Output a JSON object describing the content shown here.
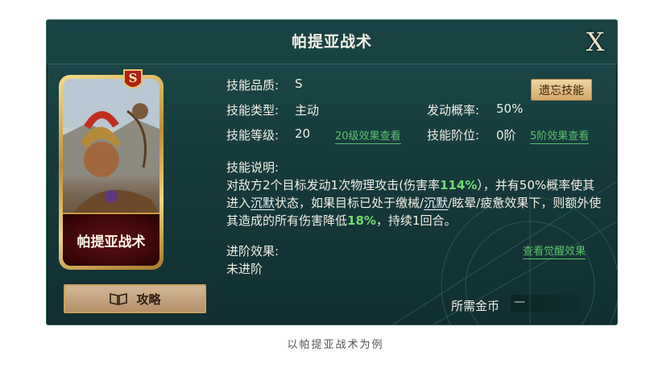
{
  "window": {
    "title": "帕提亚战术",
    "close_label": "X"
  },
  "card": {
    "grade_letter": "S",
    "name": "帕提亚战术"
  },
  "guide_button": {
    "label": "攻略"
  },
  "skill": {
    "quality_label": "技能品质:",
    "quality_value": "S",
    "type_label": "技能类型:",
    "type_value": "主动",
    "level_label": "技能等级:",
    "level_value": "20",
    "level_link": "20级效果查看",
    "trigger_label": "发动概率:",
    "trigger_value": "50%",
    "tier_label": "技能阶位:",
    "tier_value": "0阶",
    "tier_link": "5阶效果查看",
    "forget_button": "遗忘技能"
  },
  "description": {
    "label": "技能说明:",
    "p1": "对敌方2个目标发动1次物理攻击(伤害率",
    "dmg_rate": "114%",
    "p2": "），并有50%概率使其进入",
    "silence1": "沉默",
    "p3": "状态，如果目标已处于缴械/",
    "silence2": "沉默",
    "p4": "/眩晕/疲惫效果下，则额外使其造成的所有伤害降低",
    "reduce": "18%",
    "p5": "，持续1回合。"
  },
  "advance": {
    "label": "进阶效果:",
    "value": "未进阶",
    "awaken_link": "查看觉醒效果"
  },
  "cost": {
    "label": "所需金币",
    "value": "—"
  },
  "caption": "以帕提亚战术为例",
  "colors": {
    "panel_bg": "#163b3c",
    "highlight_green": "#6fdc6f",
    "card_frame_gold": "#c28f35"
  }
}
